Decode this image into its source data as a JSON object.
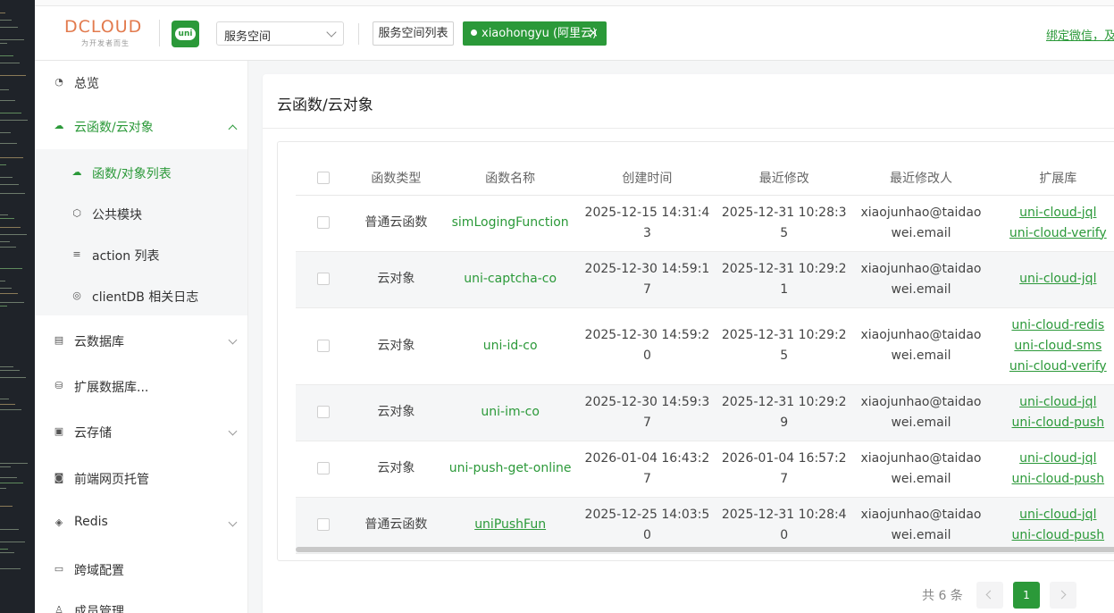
{
  "header": {
    "logo_text": "DCLOUD",
    "logo_tagline": "为开发者而生",
    "uni_badge": "uni",
    "space_select": "服务空间",
    "space_list_button": "服务空间列表",
    "space_tag": "xiaohongyu (阿里云)",
    "space_tag_close": "×",
    "bind_link": "绑定微信，及时"
  },
  "sidebar": {
    "items": [
      {
        "label": "总览",
        "icon": "dashboard-icon"
      },
      {
        "label": "云函数/云对象",
        "icon": "cloud-icon"
      },
      {
        "label": "云数据库",
        "icon": "database-icon"
      },
      {
        "label": "扩展数据库...",
        "icon": "ext-database-icon"
      },
      {
        "label": "云存储",
        "icon": "storage-icon"
      },
      {
        "label": "前端网页托管",
        "icon": "web-hosting-icon"
      },
      {
        "label": "Redis",
        "icon": "redis-icon"
      },
      {
        "label": "跨域配置",
        "icon": "cors-icon"
      },
      {
        "label": "成员管理",
        "icon": "member-icon"
      }
    ],
    "subitems": [
      {
        "label": "函数/对象列表",
        "icon": "cloud-icon"
      },
      {
        "label": "公共模块",
        "icon": "module-icon"
      },
      {
        "label": "action 列表",
        "icon": "list-icon"
      },
      {
        "label": "clientDB 相关日志",
        "icon": "log-icon"
      }
    ]
  },
  "main": {
    "title": "云函数/云对象",
    "table": {
      "headers": [
        "函数类型",
        "函数名称",
        "创建时间",
        "最近修改",
        "最近修改人",
        "扩展库"
      ],
      "rows": [
        {
          "type": "普通云函数",
          "name": "simLogingFunction",
          "created": "2025-12-15 14:31:43",
          "modified": "2025-12-31 10:28:35",
          "modifier": "xiaojunhao@taidaowei.email",
          "ext": [
            "uni-cloud-jql",
            "uni-cloud-verify"
          ]
        },
        {
          "type": "云对象",
          "name": "uni-captcha-co",
          "created": "2025-12-30 14:59:17",
          "modified": "2025-12-31 10:29:21",
          "modifier": "xiaojunhao@taidaowei.email",
          "ext": [
            "uni-cloud-jql"
          ]
        },
        {
          "type": "云对象",
          "name": "uni-id-co",
          "created": "2025-12-30 14:59:20",
          "modified": "2025-12-31 10:29:25",
          "modifier": "xiaojunhao@taidaowei.email",
          "ext": [
            "uni-cloud-redis",
            "uni-cloud-sms",
            "uni-cloud-verify"
          ]
        },
        {
          "type": "云对象",
          "name": "uni-im-co",
          "created": "2025-12-30 14:59:37",
          "modified": "2025-12-31 10:29:29",
          "modifier": "xiaojunhao@taidaowei.email",
          "ext": [
            "uni-cloud-jql",
            "uni-cloud-push"
          ]
        },
        {
          "type": "云对象",
          "name": "uni-push-get-online",
          "created": "2026-01-04 16:43:27",
          "modified": "2026-01-04 16:57:27",
          "modifier": "xiaojunhao@taidaowei.email",
          "ext": [
            "uni-cloud-jql",
            "uni-cloud-push"
          ]
        },
        {
          "type": "普通云函数",
          "name": "uniPushFun",
          "created": "2025-12-25 14:03:50",
          "modified": "2025-12-31 10:28:40",
          "modifier": "xiaojunhao@taidaowei.email",
          "ext": [
            "uni-cloud-jql",
            "uni-cloud-push"
          ]
        }
      ]
    },
    "pagination": {
      "total": "共 6 条",
      "current_page": "1"
    }
  },
  "colors": {
    "accent": "#2b9939",
    "logo_orange": "#e27a4d"
  }
}
